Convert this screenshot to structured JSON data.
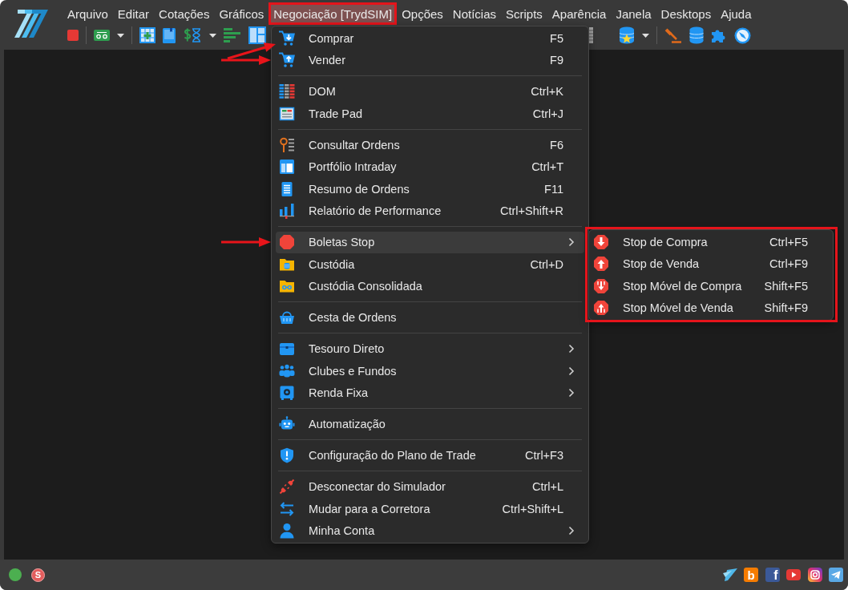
{
  "menu_bar": [
    {
      "label": "Arquivo",
      "selected": false,
      "annotated": false
    },
    {
      "label": "Editar",
      "selected": false,
      "annotated": false
    },
    {
      "label": "Cotações",
      "selected": false,
      "annotated": false
    },
    {
      "label": "Gráficos",
      "selected": false,
      "annotated": false
    },
    {
      "label": "Negociação [TrydSIM]",
      "selected": true,
      "annotated": true
    },
    {
      "label": "Opções",
      "selected": false,
      "annotated": false
    },
    {
      "label": "Notícias",
      "selected": false,
      "annotated": false
    },
    {
      "label": "Scripts",
      "selected": false,
      "annotated": false
    },
    {
      "label": "Aparência",
      "selected": false,
      "annotated": false
    },
    {
      "label": "Janela",
      "selected": false,
      "annotated": false
    },
    {
      "label": "Desktops",
      "selected": false,
      "annotated": false
    },
    {
      "label": "Ajuda",
      "selected": false,
      "annotated": false
    }
  ],
  "menu": {
    "sections": [
      {
        "items": [
          {
            "label": "Comprar",
            "shortcut": "F5",
            "has_submenu": false,
            "selected": false,
            "annotated": true
          },
          {
            "label": "Vender",
            "shortcut": "F9",
            "has_submenu": false,
            "selected": false,
            "annotated": true
          }
        ]
      },
      {
        "items": [
          {
            "label": "DOM",
            "shortcut": "Ctrl+K",
            "has_submenu": false,
            "selected": false,
            "annotated": false
          },
          {
            "label": "Trade Pad",
            "shortcut": "Ctrl+J",
            "has_submenu": false,
            "selected": false,
            "annotated": false
          }
        ]
      },
      {
        "items": [
          {
            "label": "Consultar Ordens",
            "shortcut": "F6",
            "has_submenu": false,
            "selected": false,
            "annotated": false
          },
          {
            "label": "Portfólio Intraday",
            "shortcut": "Ctrl+T",
            "has_submenu": false,
            "selected": false,
            "annotated": false
          },
          {
            "label": "Resumo de Ordens",
            "shortcut": "F11",
            "has_submenu": false,
            "selected": false,
            "annotated": false
          },
          {
            "label": "Relatório de Performance",
            "shortcut": "Ctrl+Shift+R",
            "has_submenu": false,
            "selected": false,
            "annotated": false
          }
        ]
      },
      {
        "items": [
          {
            "label": "Boletas Stop",
            "has_submenu": true,
            "selected": true,
            "annotated": true
          },
          {
            "label": "Custódia",
            "shortcut": "Ctrl+D",
            "has_submenu": false,
            "selected": false,
            "annotated": false
          },
          {
            "label": "Custódia Consolidada",
            "has_submenu": false,
            "selected": false,
            "annotated": false
          }
        ]
      },
      {
        "items": [
          {
            "label": "Cesta de Ordens",
            "has_submenu": false,
            "selected": false,
            "annotated": false
          }
        ]
      },
      {
        "items": [
          {
            "label": "Tesouro Direto",
            "has_submenu": true,
            "selected": false,
            "annotated": false
          },
          {
            "label": "Clubes e Fundos",
            "has_submenu": true,
            "selected": false,
            "annotated": false
          },
          {
            "label": "Renda Fixa",
            "has_submenu": true,
            "selected": false,
            "annotated": false
          }
        ]
      },
      {
        "items": [
          {
            "label": "Automatização",
            "has_submenu": false,
            "selected": false,
            "annotated": false
          }
        ]
      },
      {
        "items": [
          {
            "label": "Configuração do Plano de Trade",
            "shortcut": "Ctrl+F3",
            "has_submenu": false,
            "selected": false,
            "annotated": false
          }
        ]
      },
      {
        "items": [
          {
            "label": "Desconectar do Simulador",
            "shortcut": "Ctrl+L",
            "has_submenu": false,
            "selected": false,
            "annotated": false
          },
          {
            "label": "Mudar para a Corretora",
            "shortcut": "Ctrl+Shift+L",
            "has_submenu": false,
            "selected": false,
            "annotated": false
          },
          {
            "label": "Minha Conta",
            "has_submenu": true,
            "selected": false,
            "annotated": false
          }
        ]
      }
    ]
  },
  "submenu": {
    "annotated": true,
    "items": [
      {
        "label": "Stop de Compra",
        "shortcut": "Ctrl+F5",
        "selected": false
      },
      {
        "label": "Stop de Venda",
        "shortcut": "Ctrl+F9",
        "selected": false
      },
      {
        "label": "Stop Móvel de Compra",
        "shortcut": "Shift+F5",
        "selected": false
      },
      {
        "label": "Stop Móvel de Venda",
        "shortcut": "Shift+F9",
        "selected": false
      }
    ]
  },
  "status_bar": {
    "connected": true,
    "mode_badge": "S",
    "links": [
      {
        "kind": "logo"
      },
      {
        "kind": "blog",
        "text": "b"
      },
      {
        "kind": "facebook",
        "text": "f"
      },
      {
        "kind": "youtube"
      },
      {
        "kind": "instagram"
      },
      {
        "kind": "telegram"
      }
    ]
  }
}
